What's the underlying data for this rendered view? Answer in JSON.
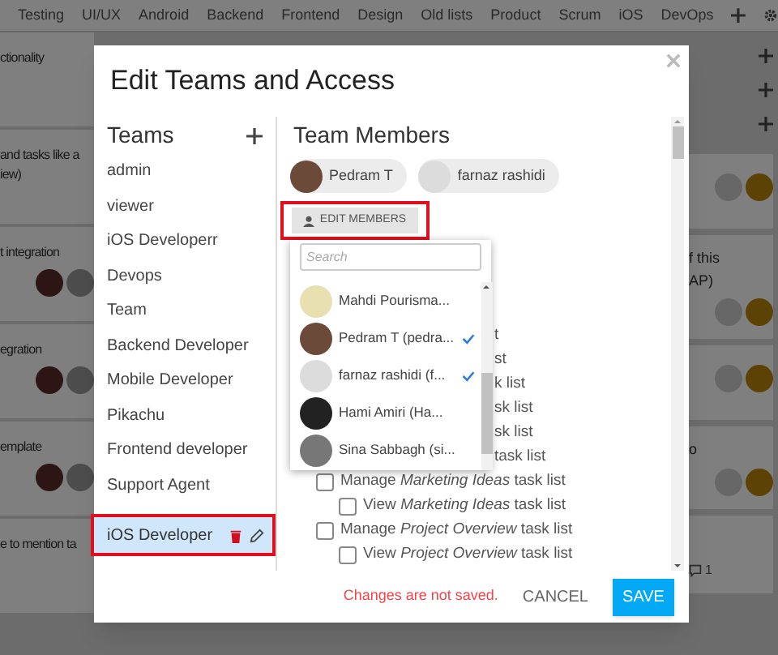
{
  "top_tabs": [
    "Testing",
    "UI/UX",
    "Android",
    "Backend",
    "Frontend",
    "Design",
    "Old lists",
    "Product",
    "Scrum",
    "iOS",
    "DevOps"
  ],
  "left_cards": [
    {
      "lines": [
        "ctionality"
      ],
      "has_avatars": false
    },
    {
      "lines": [
        "and tasks like a",
        "iew)"
      ],
      "has_avatars": false
    },
    {
      "lines": [
        "t integration"
      ],
      "has_avatars": true
    },
    {
      "lines": [
        "egration"
      ],
      "has_avatars": true
    },
    {
      "lines": [
        "emplate"
      ],
      "has_avatars": true
    },
    {
      "lines": [
        "e to mention ta"
      ],
      "has_avatars": false
    }
  ],
  "right_cards": [
    {
      "has_avatars": true
    },
    {
      "lines": [
        "f this",
        "AP)"
      ],
      "has_avatars": true
    },
    {
      "has_avatars": true
    },
    {
      "lines": [
        "o"
      ],
      "has_avatars": true
    },
    {
      "has_avatars": false,
      "comment_count": "1"
    }
  ],
  "dialog": {
    "title": "Edit Teams and Access",
    "teams_heading": "Teams",
    "teams": [
      {
        "name": "admin",
        "selected": false
      },
      {
        "name": "viewer",
        "selected": false
      },
      {
        "name": "iOS Developerr",
        "selected": false
      },
      {
        "name": "Devops",
        "selected": false
      },
      {
        "name": "Team",
        "selected": false
      },
      {
        "name": "Backend Developer",
        "selected": false
      },
      {
        "name": "Mobile Developer",
        "selected": false
      },
      {
        "name": "Pikachu",
        "selected": false
      },
      {
        "name": "Frontend developer",
        "selected": false
      },
      {
        "name": "Support Agent",
        "selected": false
      },
      {
        "name": "iOS Developer",
        "selected": true
      }
    ],
    "members_heading": "Team Members",
    "members": [
      "Pedram T",
      "farnaz rashidi"
    ],
    "edit_button": "EDIT MEMBERS",
    "member_picker": {
      "placeholder": "Search",
      "options": [
        {
          "label": "Mahdi Pourisma...",
          "selected": false
        },
        {
          "label": "Pedram T (pedra...",
          "selected": true
        },
        {
          "label": "farnaz rashidi (f...",
          "selected": true
        },
        {
          "label": "Hami Amiri (Ha...",
          "selected": false
        },
        {
          "label": "Sina Sabbagh (si...",
          "selected": false
        }
      ]
    },
    "permissions": [
      {
        "kind": "covered",
        "text": "t"
      },
      {
        "kind": "covered",
        "text": "st"
      },
      {
        "kind": "covered",
        "text": "k list"
      },
      {
        "kind": "covered",
        "text": "sk list"
      },
      {
        "kind": "covered",
        "text": "sk list"
      },
      {
        "kind": "covered",
        "text": "task list"
      },
      {
        "kind": "checkbox",
        "text": "Manage *Marketing Ideas* task list",
        "checked": false,
        "children": [
          {
            "kind": "checkbox",
            "text": "View *Marketing Ideas* task list",
            "checked": false
          }
        ]
      },
      {
        "kind": "checkbox",
        "text": "Manage *Project Overview* task list",
        "checked": false,
        "children": [
          {
            "kind": "checkbox",
            "text": "View *Project Overview* task list",
            "checked": false
          }
        ]
      }
    ],
    "unsaved_notice": "Changes are not saved.",
    "cancel": "CANCEL",
    "save": "SAVE"
  }
}
